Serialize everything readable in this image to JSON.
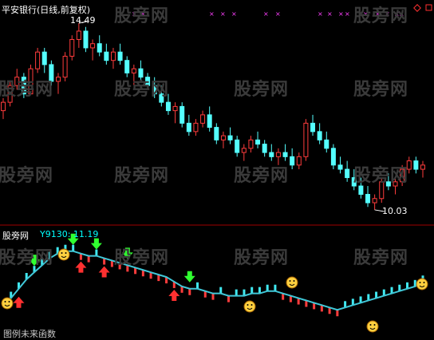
{
  "chart_title": "平安银行(日线,前复权)",
  "watermark": "股旁网",
  "lower_panel": {
    "name": "股旁网",
    "indicator_name": "Y9130",
    "indicator_value": "11.19",
    "footer": "图例未来函数"
  },
  "chart_data": [
    {
      "type": "candlestick",
      "title": "平安银行(日线,前复权)",
      "annotations": [
        {
          "text": "14.49",
          "kind": "high"
        },
        {
          "text": "10.03",
          "kind": "low"
        }
      ],
      "ohlc": [
        [
          12.4,
          12.7,
          12.2,
          12.6
        ],
        [
          12.6,
          13.1,
          12.5,
          13.0
        ],
        [
          13.0,
          13.4,
          12.9,
          13.2
        ],
        [
          13.2,
          13.3,
          12.7,
          12.8
        ],
        [
          12.8,
          13.5,
          12.8,
          13.4
        ],
        [
          13.4,
          13.9,
          13.3,
          13.8
        ],
        [
          13.8,
          13.9,
          13.3,
          13.5
        ],
        [
          13.5,
          13.6,
          13.0,
          13.1
        ],
        [
          13.1,
          13.3,
          12.8,
          13.2
        ],
        [
          13.2,
          13.8,
          13.1,
          13.7
        ],
        [
          13.7,
          14.2,
          13.6,
          14.1
        ],
        [
          14.1,
          14.49,
          13.9,
          14.3
        ],
        [
          14.3,
          14.4,
          13.8,
          13.9
        ],
        [
          13.9,
          14.1,
          13.6,
          14.0
        ],
        [
          14.0,
          14.2,
          13.7,
          13.8
        ],
        [
          13.8,
          14.0,
          13.5,
          13.6
        ],
        [
          13.6,
          13.9,
          13.4,
          13.8
        ],
        [
          13.8,
          14.0,
          13.5,
          13.6
        ],
        [
          13.6,
          13.7,
          13.2,
          13.3
        ],
        [
          13.3,
          13.5,
          13.0,
          13.4
        ],
        [
          13.4,
          13.6,
          13.1,
          13.2
        ],
        [
          13.2,
          13.3,
          12.9,
          13.0
        ],
        [
          13.0,
          13.2,
          12.7,
          12.8
        ],
        [
          12.8,
          13.0,
          12.5,
          12.6
        ],
        [
          12.6,
          12.8,
          12.3,
          12.4
        ],
        [
          12.4,
          12.6,
          12.1,
          12.5
        ],
        [
          12.5,
          12.6,
          12.0,
          12.1
        ],
        [
          12.1,
          12.3,
          11.8,
          11.9
        ],
        [
          11.9,
          12.2,
          11.8,
          12.1
        ],
        [
          12.1,
          12.4,
          12.0,
          12.3
        ],
        [
          12.3,
          12.5,
          11.9,
          12.0
        ],
        [
          12.0,
          12.1,
          11.6,
          11.7
        ],
        [
          11.7,
          11.9,
          11.5,
          11.8
        ],
        [
          11.8,
          12.0,
          11.6,
          11.7
        ],
        [
          11.7,
          11.8,
          11.3,
          11.4
        ],
        [
          11.4,
          11.6,
          11.2,
          11.5
        ],
        [
          11.5,
          11.8,
          11.4,
          11.7
        ],
        [
          11.7,
          11.9,
          11.5,
          11.6
        ],
        [
          11.6,
          11.7,
          11.3,
          11.4
        ],
        [
          11.4,
          11.6,
          11.2,
          11.3
        ],
        [
          11.3,
          11.5,
          11.1,
          11.4
        ],
        [
          11.4,
          11.6,
          11.2,
          11.3
        ],
        [
          11.3,
          11.5,
          11.0,
          11.1
        ],
        [
          11.1,
          11.4,
          11.0,
          11.3
        ],
        [
          11.3,
          12.2,
          11.2,
          12.1
        ],
        [
          12.1,
          12.3,
          11.8,
          11.9
        ],
        [
          11.9,
          12.1,
          11.6,
          11.7
        ],
        [
          11.7,
          11.9,
          11.4,
          11.5
        ],
        [
          11.5,
          11.6,
          11.0,
          11.1
        ],
        [
          11.1,
          11.3,
          10.9,
          11.0
        ],
        [
          11.0,
          11.2,
          10.7,
          10.8
        ],
        [
          10.8,
          11.0,
          10.5,
          10.6
        ],
        [
          10.6,
          10.8,
          10.3,
          10.4
        ],
        [
          10.4,
          10.6,
          10.1,
          10.2
        ],
        [
          10.2,
          10.4,
          10.03,
          10.3
        ],
        [
          10.3,
          10.8,
          10.2,
          10.7
        ],
        [
          10.7,
          10.9,
          10.5,
          10.6
        ],
        [
          10.6,
          10.8,
          10.4,
          10.7
        ],
        [
          10.7,
          11.1,
          10.6,
          11.0
        ],
        [
          11.0,
          11.3,
          10.9,
          11.2
        ],
        [
          11.2,
          11.3,
          10.9,
          11.0
        ],
        [
          11.0,
          11.2,
          10.8,
          11.1
        ]
      ]
    },
    {
      "type": "line",
      "name": "Y9130",
      "last_value": 11.19,
      "values": [
        10.2,
        10.5,
        10.9,
        11.3,
        11.6,
        11.9,
        12.2,
        12.4,
        12.5,
        12.5,
        12.4,
        12.3,
        12.3,
        12.2,
        12.1,
        12.0,
        11.9,
        11.8,
        11.7,
        11.6,
        11.5,
        11.4,
        11.2,
        11.0,
        10.9,
        10.9,
        10.8,
        10.7,
        10.7,
        10.6,
        10.6,
        10.6,
        10.7,
        10.7,
        10.8,
        10.8,
        10.7,
        10.6,
        10.5,
        10.4,
        10.3,
        10.2,
        10.1,
        10.0,
        10.1,
        10.2,
        10.3,
        10.4,
        10.5,
        10.6,
        10.7,
        10.8,
        10.9,
        11.0,
        11.19
      ],
      "signals": [
        {
          "type": "up-arrow",
          "index": 2
        },
        {
          "type": "down-arrow",
          "index": 4
        },
        {
          "type": "down-arrow",
          "index": 9
        },
        {
          "type": "up-arrow",
          "index": 10
        },
        {
          "type": "down-arrow",
          "index": 12
        },
        {
          "type": "up-arrow",
          "index": 13
        },
        {
          "type": "down-arrow",
          "index": 16
        },
        {
          "type": "up-arrow",
          "index": 22
        },
        {
          "type": "down-arrow",
          "index": 24
        }
      ]
    }
  ],
  "colors": {
    "up_candle": "#ff3c3c",
    "down_candle": "#54ffff",
    "indicator_line": "#40c8d8",
    "title_text": "#ffffff",
    "indicator_label": "#00ffff",
    "grid_marks": "#ff40ff",
    "divider": "#a00000",
    "watermark": "#3a3a3a"
  }
}
